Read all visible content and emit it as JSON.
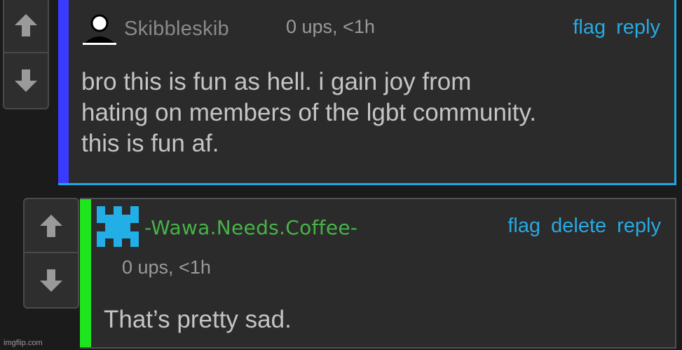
{
  "comments": [
    {
      "username": "Skibbleskib",
      "meta": "0 ups, <1h",
      "actions": [
        "flag",
        "reply"
      ],
      "body": "bro this is fun as hell. i gain joy from\nhating on members of the lgbt community.\nthis is fun af.",
      "avatar_icon": "person-silhouette-icon",
      "accent_color": "#3b3bff"
    },
    {
      "username": "-Wawa.Needs.Coffee-",
      "meta": "0 ups, <1h",
      "actions": [
        "flag",
        "delete",
        "reply"
      ],
      "body": "That’s pretty sad.",
      "avatar_icon": "castle-tower-icon",
      "accent_color": "#1ee61e"
    }
  ],
  "colors": {
    "link": "#27a9e1",
    "highlight_border": "#1fa7df",
    "username_green": "#47b347",
    "background": "#1b1b1b",
    "panel": "#2b2b2b"
  },
  "watermark": "imgflip.com"
}
